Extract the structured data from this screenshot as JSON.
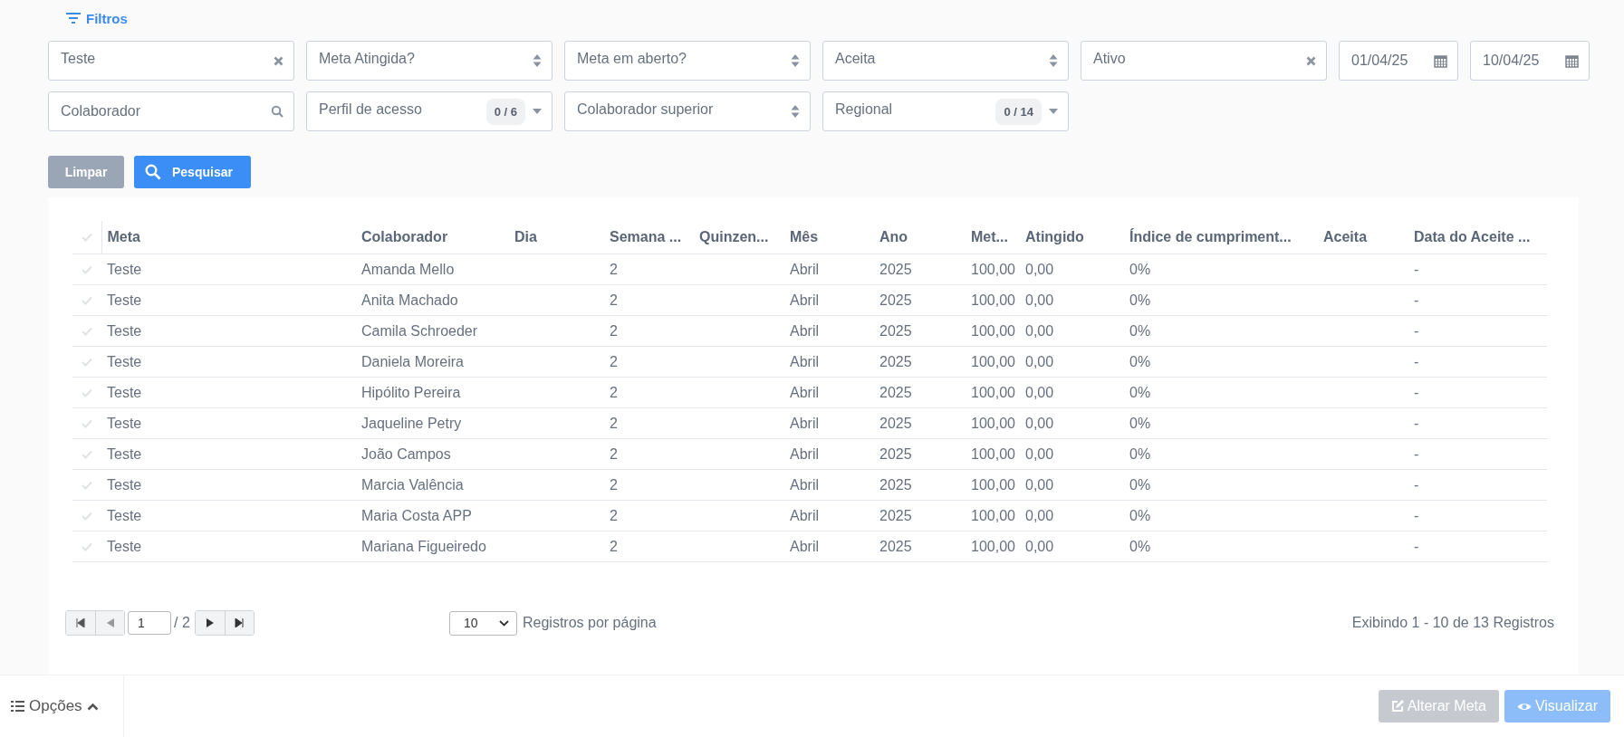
{
  "filters_toggle": {
    "label": "Filtros"
  },
  "filter_rows": [
    [
      {
        "kind": "clear",
        "value": "Teste"
      },
      {
        "kind": "select",
        "placeholder": "Meta Atingida?"
      },
      {
        "kind": "select",
        "placeholder": "Meta em aberto?"
      },
      {
        "kind": "select",
        "value": "Aceita"
      },
      {
        "kind": "clear",
        "value": "Ativo"
      },
      {
        "kind": "date",
        "value": "01/04/25"
      },
      {
        "kind": "date",
        "value": "10/04/25"
      }
    ],
    [
      {
        "kind": "search",
        "placeholder": "Colaborador"
      },
      {
        "kind": "multi",
        "placeholder": "Perfil de acesso",
        "count": "0 / 6"
      },
      {
        "kind": "select",
        "placeholder": "Colaborador superior"
      },
      {
        "kind": "multi",
        "placeholder": "Regional",
        "count": "0 / 14"
      }
    ]
  ],
  "buttons": {
    "clear": "Limpar",
    "search": "Pesquisar"
  },
  "table": {
    "columns": [
      "Meta",
      "Colaborador",
      "Dia",
      "Semana ...",
      "Quinzen...",
      "Mês",
      "Ano",
      "Met...",
      "Atingido",
      "Índice de cumpriment...",
      "Aceita",
      "Data do Aceite ..."
    ],
    "rows": [
      {
        "selected": false,
        "cells": [
          "Teste",
          "Amanda Mello",
          "",
          "2",
          "",
          "Abril",
          "2025",
          "100,00",
          "0,00",
          "0%",
          "",
          "-"
        ]
      },
      {
        "selected": false,
        "cells": [
          "Teste",
          "Anita Machado",
          "",
          "2",
          "",
          "Abril",
          "2025",
          "100,00",
          "0,00",
          "0%",
          "",
          "-"
        ]
      },
      {
        "selected": false,
        "cells": [
          "Teste",
          "Camila Schroeder",
          "",
          "2",
          "",
          "Abril",
          "2025",
          "100,00",
          "0,00",
          "0%",
          "",
          "-"
        ]
      },
      {
        "selected": false,
        "cells": [
          "Teste",
          "Daniela Moreira",
          "",
          "2",
          "",
          "Abril",
          "2025",
          "100,00",
          "0,00",
          "0%",
          "",
          "-"
        ]
      },
      {
        "selected": false,
        "cells": [
          "Teste",
          "Hipólito Pereira",
          "",
          "2",
          "",
          "Abril",
          "2025",
          "100,00",
          "0,00",
          "0%",
          "",
          "-"
        ]
      },
      {
        "selected": false,
        "cells": [
          "Teste",
          "Jaqueline Petry",
          "",
          "2",
          "",
          "Abril",
          "2025",
          "100,00",
          "0,00",
          "0%",
          "",
          "-"
        ]
      },
      {
        "selected": false,
        "cells": [
          "Teste",
          "João Campos",
          "",
          "2",
          "",
          "Abril",
          "2025",
          "100,00",
          "0,00",
          "0%",
          "",
          "-"
        ]
      },
      {
        "selected": false,
        "cells": [
          "Teste",
          "Marcia Valência",
          "",
          "2",
          "",
          "Abril",
          "2025",
          "100,00",
          "0,00",
          "0%",
          "",
          "-"
        ]
      },
      {
        "selected": false,
        "cells": [
          "Teste",
          "Maria Costa APP",
          "",
          "2",
          "",
          "Abril",
          "2025",
          "100,00",
          "0,00",
          "0%",
          "",
          "-"
        ]
      },
      {
        "selected": false,
        "cells": [
          "Teste",
          "Mariana Figueiredo",
          "",
          "2",
          "",
          "Abril",
          "2025",
          "100,00",
          "0,00",
          "0%",
          "",
          "-"
        ]
      }
    ]
  },
  "pagination": {
    "page": "1",
    "total_pages": "/ 2",
    "page_size": "10",
    "page_size_label": "Registros por página",
    "summary": "Exibindo 1 - 10 de 13 Registros"
  },
  "footer": {
    "options": "Opções",
    "buttons": [
      {
        "label": "Alterar Meta",
        "kind": "edit",
        "disabled": true
      },
      {
        "label": "Visualizar",
        "kind": "view",
        "disabled": true
      }
    ]
  }
}
